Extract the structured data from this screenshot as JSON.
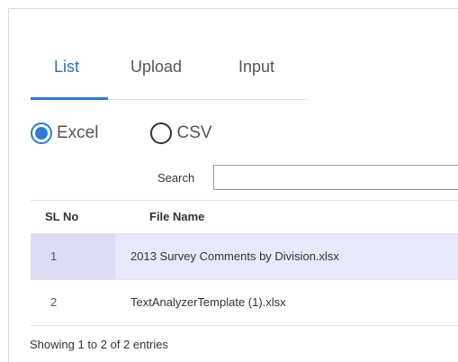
{
  "tabs": [
    {
      "label": "List",
      "active": true
    },
    {
      "label": "Upload",
      "active": false
    },
    {
      "label": "Input",
      "active": false
    }
  ],
  "file_type": {
    "options": [
      {
        "label": "Excel",
        "checked": true
      },
      {
        "label": "CSV",
        "checked": false
      }
    ]
  },
  "search": {
    "label": "Search",
    "value": "",
    "placeholder": ""
  },
  "table": {
    "columns": [
      "SL No",
      "File Name"
    ],
    "rows": [
      {
        "sl_no": "1",
        "file_name": "2013 Survey Comments by Division.xlsx"
      },
      {
        "sl_no": "2",
        "file_name": "TextAnalyzerTemplate (1).xlsx"
      }
    ]
  },
  "info_text": "Showing 1 to 2 of 2 entries",
  "colors": {
    "accent": "#2f7bd0",
    "row_highlight": "#e8e8fb"
  }
}
